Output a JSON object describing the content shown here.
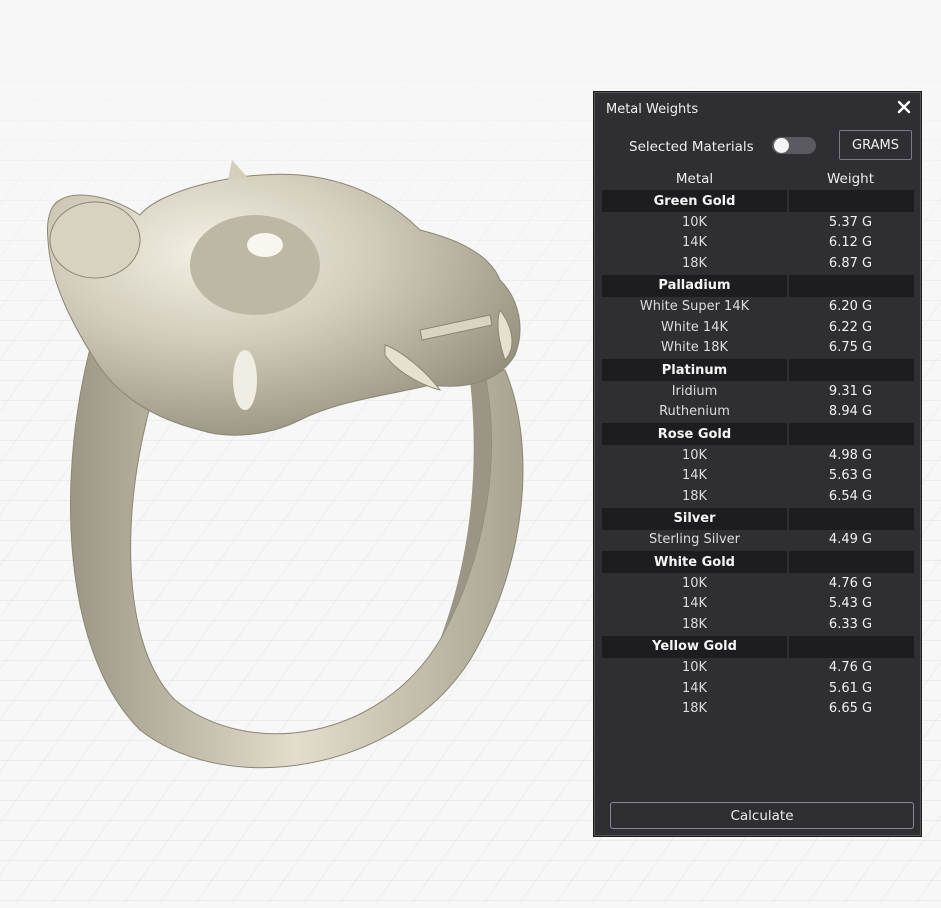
{
  "panel": {
    "title": "Metal Weights",
    "selected_materials_label": "Selected Materials",
    "selected_materials_on": false,
    "unit_button": "GRAMS",
    "col_metal": "Metal",
    "col_weight": "Weight",
    "calculate_label": "Calculate",
    "groups": [
      {
        "name": "Green Gold",
        "items": [
          {
            "metal": "10K",
            "weight": "5.37 G"
          },
          {
            "metal": "14K",
            "weight": "6.12 G"
          },
          {
            "metal": "18K",
            "weight": "6.87 G"
          }
        ]
      },
      {
        "name": "Palladium",
        "items": [
          {
            "metal": "White Super 14K",
            "weight": "6.20 G"
          },
          {
            "metal": "White 14K",
            "weight": "6.22 G"
          },
          {
            "metal": "White 18K",
            "weight": "6.75 G"
          }
        ]
      },
      {
        "name": "Platinum",
        "items": [
          {
            "metal": "Iridium",
            "weight": "9.31 G"
          },
          {
            "metal": "Ruthenium",
            "weight": "8.94 G"
          }
        ]
      },
      {
        "name": "Rose Gold",
        "items": [
          {
            "metal": "10K",
            "weight": "4.98 G"
          },
          {
            "metal": "14K",
            "weight": "5.63 G"
          },
          {
            "metal": "18K",
            "weight": "6.54 G"
          }
        ]
      },
      {
        "name": "Silver",
        "items": [
          {
            "metal": "Sterling Silver",
            "weight": "4.49 G"
          }
        ]
      },
      {
        "name": "White Gold",
        "items": [
          {
            "metal": "10K",
            "weight": "4.76 G"
          },
          {
            "metal": "14K",
            "weight": "5.43 G"
          },
          {
            "metal": "18K",
            "weight": "6.33 G"
          }
        ]
      },
      {
        "name": "Yellow Gold",
        "items": [
          {
            "metal": "10K",
            "weight": "4.76 G"
          },
          {
            "metal": "14K",
            "weight": "5.61 G"
          },
          {
            "metal": "18K",
            "weight": "6.65 G"
          }
        ]
      }
    ]
  },
  "colors": {
    "panel_bg": "#2f2f33",
    "group_bg": "#1d1d20",
    "ring_metal": "#cfcab8"
  }
}
